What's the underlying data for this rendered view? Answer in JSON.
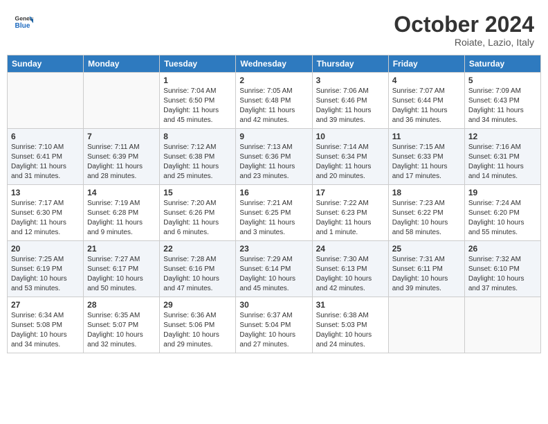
{
  "header": {
    "logo_general": "General",
    "logo_blue": "Blue",
    "month_title": "October 2024",
    "location": "Roiate, Lazio, Italy"
  },
  "weekdays": [
    "Sunday",
    "Monday",
    "Tuesday",
    "Wednesday",
    "Thursday",
    "Friday",
    "Saturday"
  ],
  "weeks": [
    [
      {
        "day": "",
        "info": ""
      },
      {
        "day": "",
        "info": ""
      },
      {
        "day": "1",
        "info": "Sunrise: 7:04 AM\nSunset: 6:50 PM\nDaylight: 11 hours and 45 minutes."
      },
      {
        "day": "2",
        "info": "Sunrise: 7:05 AM\nSunset: 6:48 PM\nDaylight: 11 hours and 42 minutes."
      },
      {
        "day": "3",
        "info": "Sunrise: 7:06 AM\nSunset: 6:46 PM\nDaylight: 11 hours and 39 minutes."
      },
      {
        "day": "4",
        "info": "Sunrise: 7:07 AM\nSunset: 6:44 PM\nDaylight: 11 hours and 36 minutes."
      },
      {
        "day": "5",
        "info": "Sunrise: 7:09 AM\nSunset: 6:43 PM\nDaylight: 11 hours and 34 minutes."
      }
    ],
    [
      {
        "day": "6",
        "info": "Sunrise: 7:10 AM\nSunset: 6:41 PM\nDaylight: 11 hours and 31 minutes."
      },
      {
        "day": "7",
        "info": "Sunrise: 7:11 AM\nSunset: 6:39 PM\nDaylight: 11 hours and 28 minutes."
      },
      {
        "day": "8",
        "info": "Sunrise: 7:12 AM\nSunset: 6:38 PM\nDaylight: 11 hours and 25 minutes."
      },
      {
        "day": "9",
        "info": "Sunrise: 7:13 AM\nSunset: 6:36 PM\nDaylight: 11 hours and 23 minutes."
      },
      {
        "day": "10",
        "info": "Sunrise: 7:14 AM\nSunset: 6:34 PM\nDaylight: 11 hours and 20 minutes."
      },
      {
        "day": "11",
        "info": "Sunrise: 7:15 AM\nSunset: 6:33 PM\nDaylight: 11 hours and 17 minutes."
      },
      {
        "day": "12",
        "info": "Sunrise: 7:16 AM\nSunset: 6:31 PM\nDaylight: 11 hours and 14 minutes."
      }
    ],
    [
      {
        "day": "13",
        "info": "Sunrise: 7:17 AM\nSunset: 6:30 PM\nDaylight: 11 hours and 12 minutes."
      },
      {
        "day": "14",
        "info": "Sunrise: 7:19 AM\nSunset: 6:28 PM\nDaylight: 11 hours and 9 minutes."
      },
      {
        "day": "15",
        "info": "Sunrise: 7:20 AM\nSunset: 6:26 PM\nDaylight: 11 hours and 6 minutes."
      },
      {
        "day": "16",
        "info": "Sunrise: 7:21 AM\nSunset: 6:25 PM\nDaylight: 11 hours and 3 minutes."
      },
      {
        "day": "17",
        "info": "Sunrise: 7:22 AM\nSunset: 6:23 PM\nDaylight: 11 hours and 1 minute."
      },
      {
        "day": "18",
        "info": "Sunrise: 7:23 AM\nSunset: 6:22 PM\nDaylight: 10 hours and 58 minutes."
      },
      {
        "day": "19",
        "info": "Sunrise: 7:24 AM\nSunset: 6:20 PM\nDaylight: 10 hours and 55 minutes."
      }
    ],
    [
      {
        "day": "20",
        "info": "Sunrise: 7:25 AM\nSunset: 6:19 PM\nDaylight: 10 hours and 53 minutes."
      },
      {
        "day": "21",
        "info": "Sunrise: 7:27 AM\nSunset: 6:17 PM\nDaylight: 10 hours and 50 minutes."
      },
      {
        "day": "22",
        "info": "Sunrise: 7:28 AM\nSunset: 6:16 PM\nDaylight: 10 hours and 47 minutes."
      },
      {
        "day": "23",
        "info": "Sunrise: 7:29 AM\nSunset: 6:14 PM\nDaylight: 10 hours and 45 minutes."
      },
      {
        "day": "24",
        "info": "Sunrise: 7:30 AM\nSunset: 6:13 PM\nDaylight: 10 hours and 42 minutes."
      },
      {
        "day": "25",
        "info": "Sunrise: 7:31 AM\nSunset: 6:11 PM\nDaylight: 10 hours and 39 minutes."
      },
      {
        "day": "26",
        "info": "Sunrise: 7:32 AM\nSunset: 6:10 PM\nDaylight: 10 hours and 37 minutes."
      }
    ],
    [
      {
        "day": "27",
        "info": "Sunrise: 6:34 AM\nSunset: 5:08 PM\nDaylight: 10 hours and 34 minutes."
      },
      {
        "day": "28",
        "info": "Sunrise: 6:35 AM\nSunset: 5:07 PM\nDaylight: 10 hours and 32 minutes."
      },
      {
        "day": "29",
        "info": "Sunrise: 6:36 AM\nSunset: 5:06 PM\nDaylight: 10 hours and 29 minutes."
      },
      {
        "day": "30",
        "info": "Sunrise: 6:37 AM\nSunset: 5:04 PM\nDaylight: 10 hours and 27 minutes."
      },
      {
        "day": "31",
        "info": "Sunrise: 6:38 AM\nSunset: 5:03 PM\nDaylight: 10 hours and 24 minutes."
      },
      {
        "day": "",
        "info": ""
      },
      {
        "day": "",
        "info": ""
      }
    ]
  ]
}
